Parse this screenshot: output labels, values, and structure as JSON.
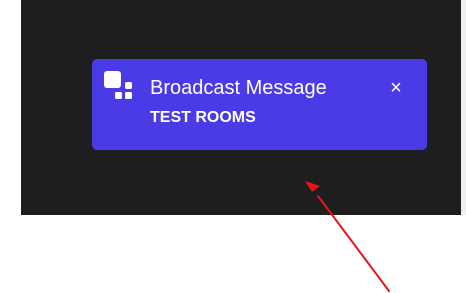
{
  "notification": {
    "title": "Broadcast Message",
    "subtitle": "TEST ROOMS",
    "close_label": "×",
    "icon": "broadcast-icon",
    "background_color": "#4a3be6",
    "text_color": "#ffffff"
  },
  "annotation": {
    "type": "red-arrow",
    "color": "#e8141b"
  }
}
